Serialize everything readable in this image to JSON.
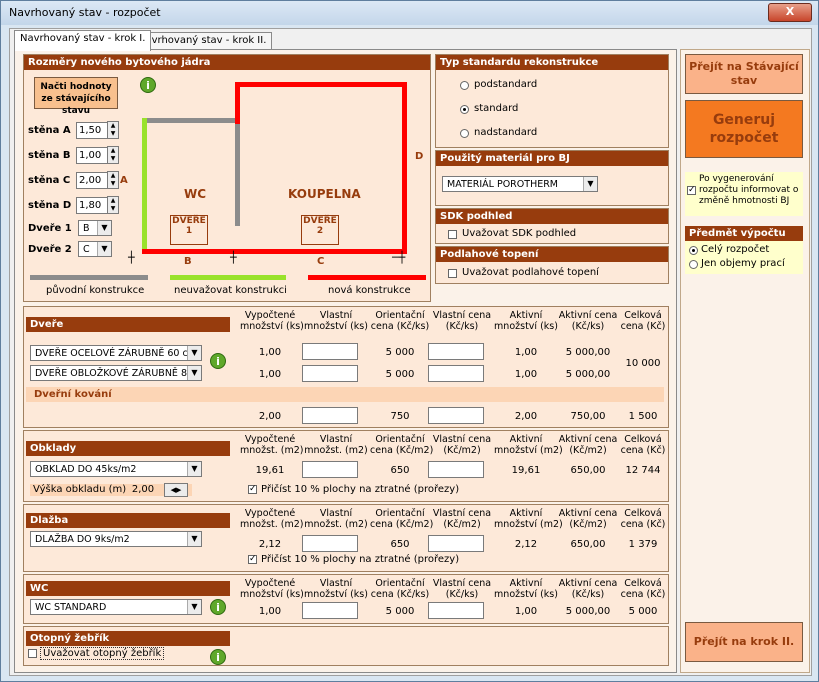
{
  "window": {
    "title": "Navrhovaný stav - rozpočet",
    "close": "X"
  },
  "tabs": [
    {
      "label": "Navrhovaný stav - krok I."
    },
    {
      "label": "Navrhovaný stav - krok II."
    }
  ],
  "dims": {
    "header": "Rozměry nového bytového jádra",
    "load_button": "Načti hodnoty ze stávajícího stavu",
    "rows": [
      {
        "label": "stěna A",
        "value": "1,50"
      },
      {
        "label": "stěna B",
        "value": "1,00"
      },
      {
        "label": "stěna C",
        "value": "2,00"
      },
      {
        "label": "stěna D",
        "value": "1,80"
      }
    ],
    "doors": [
      {
        "label": "Dveře 1",
        "value": "B"
      },
      {
        "label": "Dveře 2",
        "value": "C"
      }
    ],
    "plan": {
      "wc": "WC",
      "koupelna": "KOUPELNA",
      "a": "A",
      "d": "D",
      "dvere1": "DVEŘE",
      "dvere1_n": "1",
      "dvere2": "DVEŘE",
      "dvere2_n": "2",
      "b": "B",
      "c": "C"
    },
    "legend": {
      "original": "původní konstrukce",
      "ignore": "neuvažovat konstrukci",
      "new": "nová konstrukce"
    }
  },
  "standard": {
    "header": "Typ standardu rekonstrukce",
    "options": [
      "podstandard",
      "standard",
      "nadstandard"
    ],
    "selected": 1
  },
  "material": {
    "header": "Použitý materiál pro BJ",
    "value": "MATERIÁL POROTHERM"
  },
  "sdk": {
    "header": "SDK podhled",
    "label": "Uvažovat SDK podhled"
  },
  "floor_heating": {
    "header": "Podlahové topení",
    "label": "Uvažovat podlahové topení"
  },
  "columns": {
    "vyp_ks": "Vypočtené\nmnožství (ks)",
    "vl_ks": "Vlastní\nmnožství (ks)",
    "or_ks": "Orientační\ncena (Kč/ks)",
    "vlc_ks": "Vlastní cena\n(Kč/ks)",
    "akt_ks": "Aktivní\nmnožství (ks)",
    "aktc_ks": "Aktivní cena\n(Kč/ks)",
    "celk": "Celková\ncena (Kč)",
    "vyp_m2": "Vypočtené\nmnožst. (m2)",
    "vl_m2": "Vlastní\nmnožst. (m2)",
    "or_m2": "Orientační\ncena (Kč/m2)",
    "vlc_m2": "Vlastní cena\n(Kč/m2)",
    "akt_m2": "Aktivní\nmnožství (m2)",
    "aktc_m2": "Aktivní cena\n(Kč/m2)",
    "celk2": "Celková\ncena (Kč)"
  },
  "doors_section": {
    "header": "Dveře",
    "rows": [
      {
        "type": "DVEŘE OCELOVÉ ZÁRUBNĚ 60 cm",
        "vyp": "1,00",
        "or": "5 000",
        "akt": "1,00",
        "aktc": "5 000,00"
      },
      {
        "type": "DVEŘE OBLOŽKOVÉ ZÁRUBNĚ 80 cm",
        "vyp": "1,00",
        "or": "5 000",
        "akt": "1,00",
        "aktc": "5 000,00"
      }
    ],
    "total": "10 000",
    "hardware": {
      "header": "Dveřní kování",
      "vyp": "2,00",
      "or": "750",
      "akt": "2,00",
      "aktc": "750,00",
      "celk": "1 500"
    }
  },
  "tiles": {
    "header": "Obklady",
    "type": "OBKLAD DO 45ks/m2",
    "vyp": "19,61",
    "or": "650",
    "akt": "19,61",
    "aktc": "650,00",
    "celk": "12 744",
    "height_label": "Výška obkladu (m)",
    "height_value": "2,00",
    "waste": "Přičíst 10 % plochy na ztratné (prořezy)"
  },
  "floor": {
    "header": "Dlažba",
    "type": "DLAŽBA DO 9ks/m2",
    "vyp": "2,12",
    "or": "650",
    "akt": "2,12",
    "aktc": "650,00",
    "celk": "1 379",
    "waste": "Přičíst 10 % plochy na ztratné (prořezy)"
  },
  "wc": {
    "header": "WC",
    "type": "WC STANDARD",
    "vyp": "1,00",
    "or": "5 000",
    "akt": "1,00",
    "aktc": "5 000,00",
    "celk": "5 000"
  },
  "heater": {
    "header": "Otopný žebřík",
    "label": "Uvažovat otopný žebřík"
  },
  "right": {
    "goto_existing": "Přejít na Stávající stav",
    "generate": "Generuj rozpočet",
    "notify": "Po vygenerování rozpočtu informovat o změně hmotnosti BJ",
    "subject_header": "Předmět výpočtu",
    "subject_options": [
      "Celý rozpočet",
      "Jen objemy prací"
    ],
    "goto_step2": "Přejít na krok II."
  },
  "colors": {
    "header": "#973c0d",
    "panel": "#fde9d9",
    "button": "#fab289",
    "generate": "#f47920"
  }
}
